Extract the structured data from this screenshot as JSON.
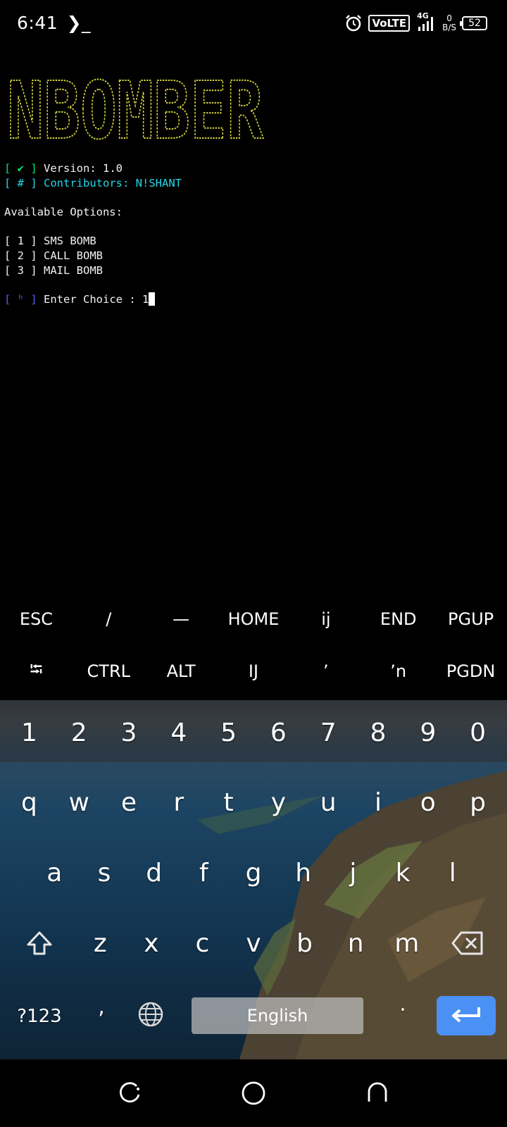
{
  "status_bar": {
    "time": "6:41",
    "terminal_indicator": "❯_",
    "volte": "VoLTE",
    "network": "4G",
    "speed_value": "0",
    "speed_unit": "B/S",
    "battery": "52"
  },
  "terminal": {
    "banner_text": "NBOMBER",
    "version_tag": "[ ✔ ]",
    "version_text": "Version: 1.0",
    "contrib_tag": "[ # ]",
    "contrib_text": "Contributors: N!SHANT",
    "options_heading": "Available Options:",
    "options": [
      {
        "tag": "[ 1 ]",
        "label": "SMS BOMB"
      },
      {
        "tag": "[ 2 ]",
        "label": "CALL BOMB"
      },
      {
        "tag": "[ 3 ]",
        "label": "MAIL BOMB"
      }
    ],
    "prompt_tag": "[ ʰ ]",
    "prompt_text": "Enter Choice : ",
    "input_value": "1"
  },
  "extra_keys": {
    "row1": [
      "ESC",
      "/",
      "—",
      "HOME",
      "ĳ",
      "END",
      "PGUP"
    ],
    "row2": [
      "⭾",
      "CTRL",
      "ALT",
      "Ĳ",
      "ʼ",
      "ʼn",
      "PGDN"
    ]
  },
  "keyboard": {
    "numbers": [
      "1",
      "2",
      "3",
      "4",
      "5",
      "6",
      "7",
      "8",
      "9",
      "0"
    ],
    "row1": [
      "q",
      "w",
      "e",
      "r",
      "t",
      "y",
      "u",
      "i",
      "o",
      "p"
    ],
    "row2": [
      "a",
      "s",
      "d",
      "f",
      "g",
      "h",
      "j",
      "k",
      "l"
    ],
    "row3": [
      "z",
      "x",
      "c",
      "v",
      "b",
      "n",
      "m"
    ],
    "symbols_label": "?123",
    "comma": ",",
    "space_label": "English",
    "period": ".",
    "icons": {
      "shift": "shift-icon",
      "backspace": "backspace-icon",
      "globe": "globe-icon",
      "enter": "enter-icon"
    },
    "accent_color": "#4a90f5"
  },
  "colors": {
    "banner": "#d4d23a",
    "green": "#00e676",
    "cyan": "#23d7e8",
    "blue": "#5b5cf0"
  }
}
